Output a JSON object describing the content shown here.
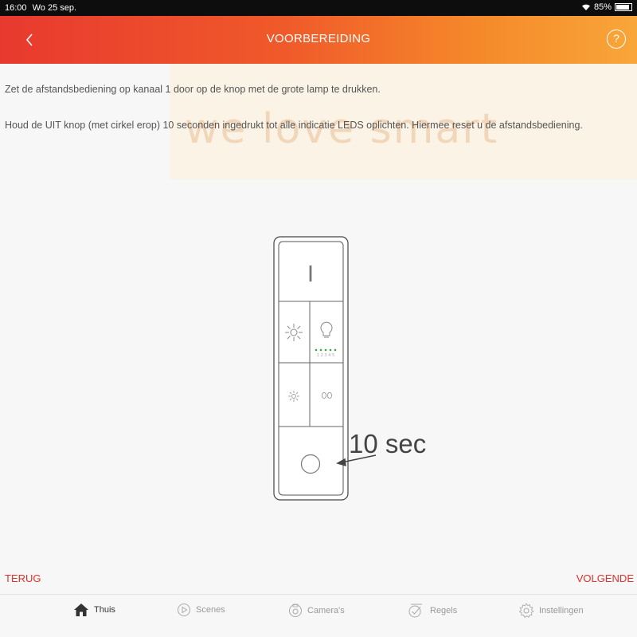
{
  "status_bar": {
    "time": "16:00",
    "date": "Wo 25 sep.",
    "battery": "85%"
  },
  "header": {
    "title": "VOORBEREIDING",
    "back_icon": "chevron-left-icon",
    "help_label": "?"
  },
  "watermark": {
    "text": "we love smart"
  },
  "instructions": [
    "Zet de afstandsbediening op kanaal 1 door op de knop met de grote lamp te drukken.",
    "Houd de UIT knop (met cirkel erop) 10 seconden ingedrukt tot alle indicatie LEDS oplichten. Hiermee reset u de afstandsbediening."
  ],
  "illustration": {
    "on_symbol": "I",
    "led_labels": "1 2 3 4 5",
    "duration_label": "10 sec"
  },
  "footer": {
    "back_label": "TERUG",
    "next_label": "VOLGENDE"
  },
  "tabs": [
    {
      "label": "Thuis",
      "icon": "home-icon",
      "active": true
    },
    {
      "label": "Scenes",
      "icon": "play-icon",
      "active": false
    },
    {
      "label": "Camera's",
      "icon": "camera-icon",
      "active": false
    },
    {
      "label": "Regels",
      "icon": "rules-icon",
      "active": false
    },
    {
      "label": "Instellingen",
      "icon": "gear-icon",
      "active": false
    }
  ],
  "colors": {
    "accent": "#e0302a",
    "header_start": "#e8392f",
    "header_end": "#f8a63a",
    "led_green": "#3aa648"
  }
}
